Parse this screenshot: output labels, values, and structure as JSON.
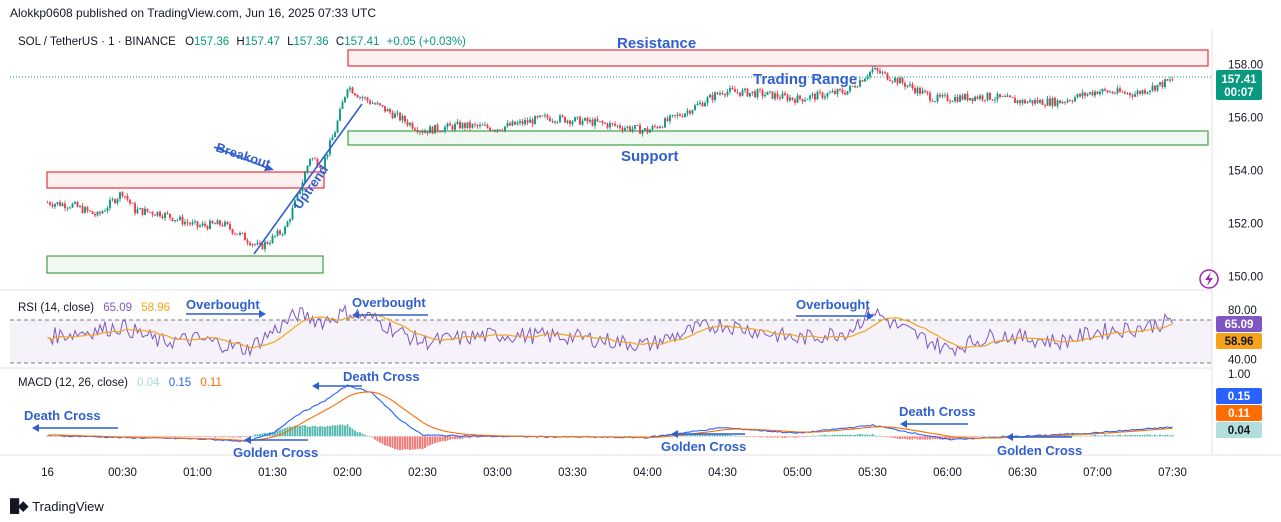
{
  "publisher_line": "Alokkp0608 published on TradingView.com, Jun 16, 2025 07:33 UTC",
  "footer": {
    "brand": "TradingView"
  },
  "price_panel": {
    "symbol": "SOL / TetherUS · 1 · BINANCE",
    "ohlc": {
      "o_label": "O",
      "o": "157.36",
      "h_label": "H",
      "h": "157.47",
      "l_label": "L",
      "l": "157.36",
      "c_label": "C",
      "c": "157.41",
      "change": "+0.05 (+0.03%)"
    },
    "last_price": "157.41",
    "countdown": "00:07",
    "annotations": {
      "resistance": "Resistance",
      "trading_range": "Trading Range",
      "support": "Support",
      "breakout": "Breakout",
      "uptrend": "Uptrend"
    }
  },
  "rsi_panel": {
    "legend": "RSI (14, close)",
    "value1": "65.09",
    "value2": "58.96",
    "badge_rsi": "65.09",
    "badge_ma": "58.96",
    "annotations": {
      "ob1": "Overbought",
      "ob2": "Overbought",
      "ob3": "Overbought"
    }
  },
  "macd_panel": {
    "legend": "MACD (12, 26, close)",
    "v_hist": "0.04",
    "v_macd": "0.15",
    "v_signal": "0.11",
    "badge_macd": "0.15",
    "badge_signal": "0.11",
    "badge_hist": "0.04",
    "annotations": {
      "dc1": "Death Cross",
      "gc1": "Golden Cross",
      "dc2": "Death Cross",
      "gc2": "Golden Cross",
      "dc3": "Death Cross",
      "gc3": "Golden Cross"
    }
  },
  "colors": {
    "up": "#089981",
    "down": "#f23645",
    "rsi": "#7e57c2",
    "rsi_ma": "#f6a31a",
    "macd": "#2962ff",
    "signal": "#ff6d00",
    "annotation": "#2f5fd0",
    "resistance_box": "#e8343c",
    "support_box": "#43a047",
    "price_badge": "#089981"
  },
  "chart_data": [
    {
      "type": "candlestick",
      "title": "SOL / TetherUS · 1 · BINANCE",
      "x_ticks": [
        "16",
        "00:30",
        "01:00",
        "01:30",
        "02:00",
        "02:30",
        "03:00",
        "03:30",
        "04:00",
        "04:30",
        "05:00",
        "05:30",
        "06:00",
        "06:30",
        "07:00",
        "07:30"
      ],
      "y_ticks": [
        "150.00",
        "152.00",
        "154.00",
        "156.00",
        "158.00"
      ],
      "ylim": [
        149.5,
        159.3
      ],
      "price_path": [
        {
          "t": "00:00",
          "p": 152.8
        },
        {
          "t": "00:10",
          "p": 152.7
        },
        {
          "t": "00:20",
          "p": 152.3
        },
        {
          "t": "00:30",
          "p": 153.2
        },
        {
          "t": "00:35",
          "p": 152.5
        },
        {
          "t": "00:45",
          "p": 152.4
        },
        {
          "t": "01:00",
          "p": 151.9
        },
        {
          "t": "01:10",
          "p": 152.0
        },
        {
          "t": "01:20",
          "p": 151.4
        },
        {
          "t": "01:25",
          "p": 151.1
        },
        {
          "t": "01:35",
          "p": 151.8
        },
        {
          "t": "01:40",
          "p": 153.0
        },
        {
          "t": "01:45",
          "p": 154.5
        },
        {
          "t": "01:50",
          "p": 154.2
        },
        {
          "t": "01:55",
          "p": 155.5
        },
        {
          "t": "02:00",
          "p": 157.2
        },
        {
          "t": "02:05",
          "p": 156.8
        },
        {
          "t": "02:15",
          "p": 156.3
        },
        {
          "t": "02:30",
          "p": 155.5
        },
        {
          "t": "02:45",
          "p": 155.7
        },
        {
          "t": "03:00",
          "p": 155.6
        },
        {
          "t": "03:20",
          "p": 156.0
        },
        {
          "t": "03:40",
          "p": 155.8
        },
        {
          "t": "04:00",
          "p": 155.5
        },
        {
          "t": "04:15",
          "p": 156.2
        },
        {
          "t": "04:30",
          "p": 157.0
        },
        {
          "t": "04:45",
          "p": 156.9
        },
        {
          "t": "05:00",
          "p": 156.7
        },
        {
          "t": "05:20",
          "p": 157.0
        },
        {
          "t": "05:30",
          "p": 157.8
        },
        {
          "t": "05:40",
          "p": 157.4
        },
        {
          "t": "05:55",
          "p": 156.7
        },
        {
          "t": "06:15",
          "p": 156.8
        },
        {
          "t": "06:30",
          "p": 156.6
        },
        {
          "t": "06:45",
          "p": 156.6
        },
        {
          "t": "07:00",
          "p": 157.0
        },
        {
          "t": "07:15",
          "p": 156.9
        },
        {
          "t": "07:30",
          "p": 157.41
        }
      ],
      "zones": [
        {
          "name": "Resistance",
          "low": 157.8,
          "high": 158.35
        },
        {
          "name": "Support",
          "low": 155.1,
          "high": 155.6
        },
        {
          "name": "",
          "low": 153.55,
          "high": 154.1
        },
        {
          "name": "",
          "low": 150.5,
          "high": 151.05
        }
      ],
      "last_price": 157.41
    },
    {
      "type": "line",
      "title": "RSI (14, close)",
      "y_ticks": [
        "80.00",
        "40.00"
      ],
      "levels": [
        70,
        30
      ],
      "ylim": [
        20,
        95
      ],
      "series": [
        {
          "name": "RSI",
          "last": 65.09
        },
        {
          "name": "RSI MA",
          "last": 58.96
        }
      ],
      "rsi_path": [
        {
          "t": "00:00",
          "v": 50
        },
        {
          "t": "00:30",
          "v": 60
        },
        {
          "t": "00:45",
          "v": 45
        },
        {
          "t": "01:00",
          "v": 48
        },
        {
          "t": "01:20",
          "v": 38
        },
        {
          "t": "01:30",
          "v": 55
        },
        {
          "t": "01:40",
          "v": 72
        },
        {
          "t": "01:50",
          "v": 65
        },
        {
          "t": "02:00",
          "v": 74
        },
        {
          "t": "02:10",
          "v": 68
        },
        {
          "t": "02:20",
          "v": 55
        },
        {
          "t": "02:30",
          "v": 45
        },
        {
          "t": "03:00",
          "v": 52
        },
        {
          "t": "03:30",
          "v": 50
        },
        {
          "t": "04:00",
          "v": 42
        },
        {
          "t": "04:20",
          "v": 58
        },
        {
          "t": "04:30",
          "v": 62
        },
        {
          "t": "05:00",
          "v": 48
        },
        {
          "t": "05:20",
          "v": 55
        },
        {
          "t": "05:30",
          "v": 75
        },
        {
          "t": "05:40",
          "v": 60
        },
        {
          "t": "06:00",
          "v": 38
        },
        {
          "t": "06:20",
          "v": 52
        },
        {
          "t": "06:45",
          "v": 45
        },
        {
          "t": "07:00",
          "v": 55
        },
        {
          "t": "07:15",
          "v": 58
        },
        {
          "t": "07:30",
          "v": 65.09
        }
      ]
    },
    {
      "type": "line",
      "title": "MACD (12, 26, close)",
      "y_ticks": [
        "1.00"
      ],
      "ylim": [
        -0.3,
        1.1
      ],
      "series": [
        {
          "name": "MACD",
          "last": 0.15
        },
        {
          "name": "Signal",
          "last": 0.11
        },
        {
          "name": "Histogram",
          "last": 0.04
        }
      ],
      "macd_path": [
        {
          "t": "00:00",
          "v": 0.02
        },
        {
          "t": "00:30",
          "v": -0.02
        },
        {
          "t": "01:00",
          "v": -0.04
        },
        {
          "t": "01:20",
          "v": -0.08
        },
        {
          "t": "01:30",
          "v": 0.05
        },
        {
          "t": "01:40",
          "v": 0.35
        },
        {
          "t": "01:50",
          "v": 0.55
        },
        {
          "t": "02:00",
          "v": 0.82
        },
        {
          "t": "02:10",
          "v": 0.7
        },
        {
          "t": "02:20",
          "v": 0.3
        },
        {
          "t": "02:30",
          "v": 0.02
        },
        {
          "t": "03:00",
          "v": 0.0
        },
        {
          "t": "04:00",
          "v": -0.02
        },
        {
          "t": "04:30",
          "v": 0.14
        },
        {
          "t": "05:00",
          "v": 0.05
        },
        {
          "t": "05:30",
          "v": 0.18
        },
        {
          "t": "06:00",
          "v": -0.05
        },
        {
          "t": "06:30",
          "v": 0.0
        },
        {
          "t": "07:00",
          "v": 0.06
        },
        {
          "t": "07:30",
          "v": 0.15
        }
      ]
    }
  ]
}
